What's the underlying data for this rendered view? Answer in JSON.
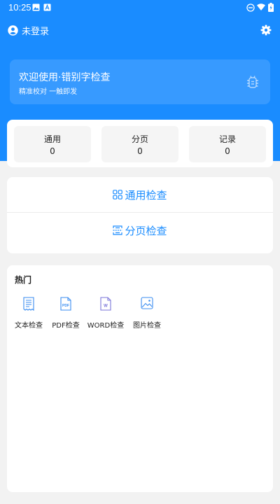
{
  "status_bar": {
    "time": "10:25"
  },
  "header": {
    "user_label": "未登录"
  },
  "banner": {
    "title": "欢迎使用·错别字检查",
    "subtitle": "精准校对 一触即发"
  },
  "stats": [
    {
      "label": "通用",
      "value": "0"
    },
    {
      "label": "分页",
      "value": "0"
    },
    {
      "label": "记录",
      "value": "0"
    }
  ],
  "actions": {
    "general_check": "通用检查",
    "paged_check": "分页检查"
  },
  "hot": {
    "title": "热门",
    "tools": [
      {
        "label": "文本检查",
        "icon": "text-doc-icon"
      },
      {
        "label": "PDF检查",
        "icon": "pdf-icon"
      },
      {
        "label": "WORD检查",
        "icon": "word-icon"
      },
      {
        "label": "图片检查",
        "icon": "image-icon"
      }
    ]
  },
  "colors": {
    "accent": "#1a8cff",
    "background": "#f2f2f2"
  }
}
